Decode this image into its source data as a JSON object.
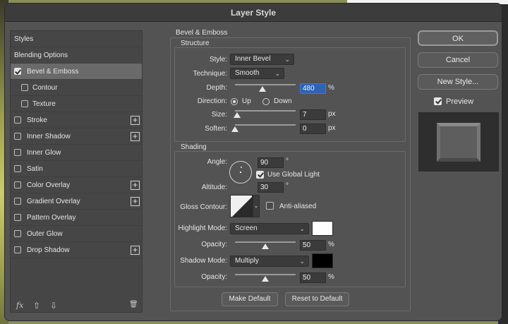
{
  "window": {
    "title": "Layer Style"
  },
  "left_panel": {
    "items": [
      {
        "label": "Styles",
        "checkbox": false,
        "checked": false,
        "plus": false
      },
      {
        "label": "Blending Options",
        "checkbox": false,
        "checked": false,
        "plus": false
      },
      {
        "label": "Bevel & Emboss",
        "checkbox": true,
        "checked": true,
        "plus": false,
        "selected": true
      },
      {
        "label": "Contour",
        "checkbox": true,
        "checked": false,
        "plus": false,
        "indent": true
      },
      {
        "label": "Texture",
        "checkbox": true,
        "checked": false,
        "plus": false,
        "indent": true
      },
      {
        "label": "Stroke",
        "checkbox": true,
        "checked": false,
        "plus": true
      },
      {
        "label": "Inner Shadow",
        "checkbox": true,
        "checked": false,
        "plus": true
      },
      {
        "label": "Inner Glow",
        "checkbox": true,
        "checked": false,
        "plus": false
      },
      {
        "label": "Satin",
        "checkbox": true,
        "checked": false,
        "plus": false
      },
      {
        "label": "Color Overlay",
        "checkbox": true,
        "checked": false,
        "plus": true
      },
      {
        "label": "Gradient Overlay",
        "checkbox": true,
        "checked": false,
        "plus": true
      },
      {
        "label": "Pattern Overlay",
        "checkbox": true,
        "checked": false,
        "plus": false
      },
      {
        "label": "Outer Glow",
        "checkbox": true,
        "checked": false,
        "plus": false
      },
      {
        "label": "Drop Shadow",
        "checkbox": true,
        "checked": false,
        "plus": true
      }
    ],
    "footer": {
      "fx": "fx",
      "up": "⇧",
      "down": "⇩",
      "trash": "🗑"
    }
  },
  "bevel": {
    "section_title": "Bevel & Emboss",
    "structure": {
      "title": "Structure",
      "style_label": "Style:",
      "style_value": "Inner Bevel",
      "technique_label": "Technique:",
      "technique_value": "Smooth",
      "depth_label": "Depth:",
      "depth_value": "480",
      "depth_unit": "%",
      "depth_slider": 0.45,
      "direction_label": "Direction:",
      "dir_up": "Up",
      "dir_down": "Down",
      "direction_selected": "Up",
      "size_label": "Size:",
      "size_value": "7",
      "size_unit": "px",
      "size_slider": 0.03,
      "soften_label": "Soften:",
      "soften_value": "0",
      "soften_unit": "px",
      "soften_slider": 0.0
    },
    "shading": {
      "title": "Shading",
      "angle_label": "Angle:",
      "angle_value": "90",
      "angle_unit": "°",
      "global_light_label": "Use Global Light",
      "global_light_checked": true,
      "altitude_label": "Altitude:",
      "altitude_value": "30",
      "altitude_unit": "°",
      "gloss_label": "Gloss Contour:",
      "anti_aliased_label": "Anti-aliased",
      "anti_aliased_checked": false,
      "highlight_label": "Highlight Mode:",
      "highlight_value": "Screen",
      "highlight_color": "#ffffff",
      "h_opacity_label": "Opacity:",
      "h_opacity_value": "50",
      "h_opacity_unit": "%",
      "h_opacity_slider": 0.5,
      "shadow_label": "Shadow Mode:",
      "shadow_value": "Multiply",
      "shadow_color": "#000000",
      "s_opacity_label": "Opacity:",
      "s_opacity_value": "50",
      "s_opacity_unit": "%",
      "s_opacity_slider": 0.5
    },
    "make_default": "Make Default",
    "reset_default": "Reset to Default"
  },
  "right": {
    "ok": "OK",
    "cancel": "Cancel",
    "new_style": "New Style...",
    "preview_label": "Preview",
    "preview_checked": true
  }
}
